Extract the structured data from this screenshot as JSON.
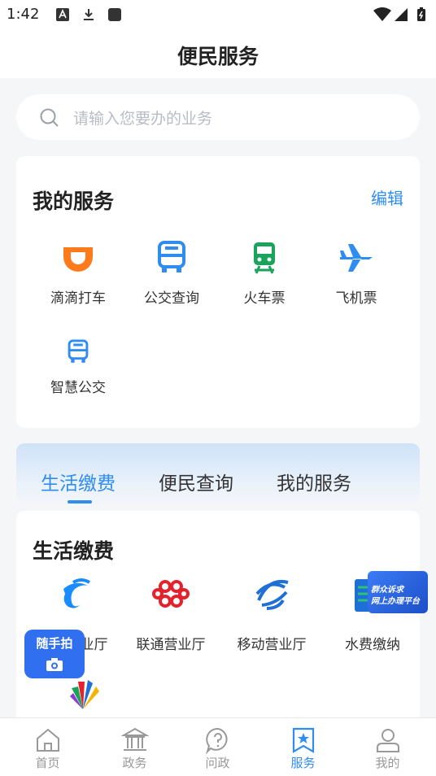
{
  "status_bar": {
    "time": "1:42"
  },
  "header": {
    "title": "便民服务"
  },
  "search": {
    "placeholder": "请输入您要办的业务"
  },
  "my_services": {
    "title": "我的服务",
    "edit_label": "编辑",
    "items": [
      {
        "label": "滴滴打车",
        "icon": "didi-icon",
        "color": "#ff7a1a"
      },
      {
        "label": "公交查询",
        "icon": "bus-icon",
        "color": "#2f8cf0"
      },
      {
        "label": "火车票",
        "icon": "train-icon",
        "color": "#1aa35a"
      },
      {
        "label": "飞机票",
        "icon": "plane-icon",
        "color": "#2f8cf0"
      },
      {
        "label": "智慧公交",
        "icon": "smart-bus-icon",
        "color": "#2f8cf0"
      }
    ]
  },
  "tabs": [
    {
      "label": "生活缴费",
      "active": true
    },
    {
      "label": "便民查询",
      "active": false
    },
    {
      "label": "我的服务",
      "active": false
    }
  ],
  "life_fees": {
    "title": "生活缴费",
    "items": [
      {
        "label": "营业厅",
        "icon": "china-telecom-icon",
        "color": "#1a8cff"
      },
      {
        "label": "联通营业厅",
        "icon": "china-unicom-icon",
        "color": "#e5212c"
      },
      {
        "label": "移动营业厅",
        "icon": "china-mobile-icon",
        "color": "#1e6fd6"
      },
      {
        "label": "水费缴纳",
        "icon": "water-fee-icon",
        "color": "#1e6fd6"
      }
    ]
  },
  "floating": {
    "snapshot_label": "随手拍",
    "promo_line1": "群众诉求",
    "promo_line2": "网上办理平台"
  },
  "bottom_nav": [
    {
      "label": "首页",
      "icon": "home-icon",
      "active": false
    },
    {
      "label": "政务",
      "icon": "government-icon",
      "active": false
    },
    {
      "label": "问政",
      "icon": "question-icon",
      "active": false
    },
    {
      "label": "服务",
      "icon": "service-star-icon",
      "active": true
    },
    {
      "label": "我的",
      "icon": "user-icon",
      "active": false
    }
  ],
  "colors": {
    "accent": "#2f8cf0",
    "fab": "#2f6ff0"
  }
}
